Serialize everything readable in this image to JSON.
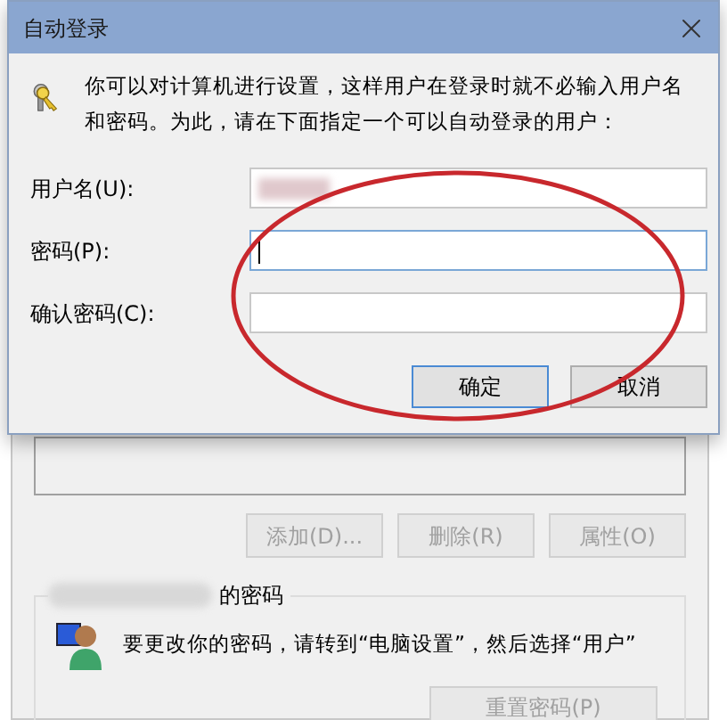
{
  "dialog": {
    "title": "自动登录",
    "message": "你可以对计算机进行设置，这样用户在登录时就不必输入用户名和密码。为此，请在下面指定一个可以自动登录的用户：",
    "fields": [
      {
        "label": "用户名(U):",
        "focused": false
      },
      {
        "label": "密码(P):",
        "focused": true
      },
      {
        "label": "确认密码(C):",
        "focused": false
      }
    ],
    "buttons": [
      {
        "label": "确定",
        "default": true
      },
      {
        "label": "取消",
        "default": false
      }
    ]
  },
  "background_window": {
    "user_buttons": [
      {
        "label": "添加(D)...",
        "disabled": true
      },
      {
        "label": "删除(R)",
        "disabled": true
      },
      {
        "label": "属性(O)",
        "disabled": true
      }
    ],
    "password_group": {
      "title": "的密码",
      "message": "要更改你的密码，请转到“电脑设置”，然后选择“用户”",
      "reset_button": {
        "label": "重置密码(P)",
        "disabled": true
      }
    }
  }
}
